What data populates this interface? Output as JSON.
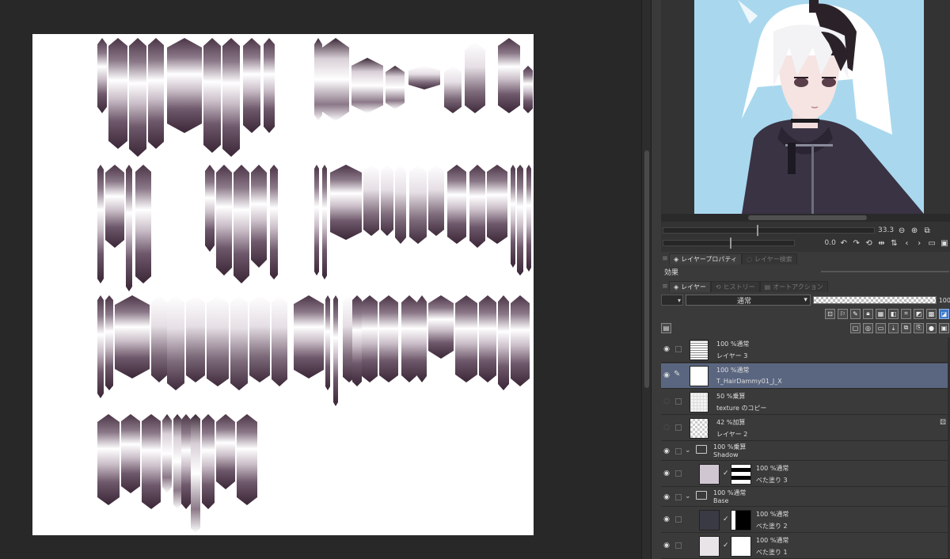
{
  "navigator": {
    "zoom": "33.3",
    "rotation": "0.0"
  },
  "tabs": {
    "layer_property": "レイヤープロパティ",
    "layer_search": "レイヤー検索",
    "effect": "効果",
    "layer": "レイヤー",
    "history": "ヒストリー",
    "auto_action": "オートアクション"
  },
  "blend": {
    "mode": "通常",
    "opacity": "100"
  },
  "layers": [
    {
      "line1": "100 %通常",
      "line2": "レイヤー 3",
      "thumb": "lines"
    },
    {
      "line1": "100 %通常",
      "line2": "T_HairDammy01_J_X",
      "thumb": "plain",
      "selected": true
    },
    {
      "line1": "50 %乗算",
      "line2": "texture のコピー",
      "thumb": "grid"
    },
    {
      "line1": "42 %加算",
      "line2": "レイヤー 2",
      "thumb": "checker"
    }
  ],
  "groups": [
    {
      "line1": "100 %乗算",
      "line2": "Shadow",
      "child": {
        "line1": "100 %通常",
        "line2": "べた塗り 3",
        "color": "#cfc6d2",
        "mask": "stripes"
      }
    },
    {
      "line1": "100 %通常",
      "line2": "Base",
      "children": [
        {
          "line1": "100 %通常",
          "line2": "べた塗り 2",
          "color": "#3a3a44",
          "mask": "half"
        },
        {
          "line1": "100 %通常",
          "line2": "べた塗り 1",
          "color": "#e8e4e8",
          "mask": "white"
        }
      ]
    }
  ],
  "colors": {
    "hair_dark": "#4a3546",
    "selected_row": "#5a6680",
    "preview_bg": "#a9d8ee"
  }
}
